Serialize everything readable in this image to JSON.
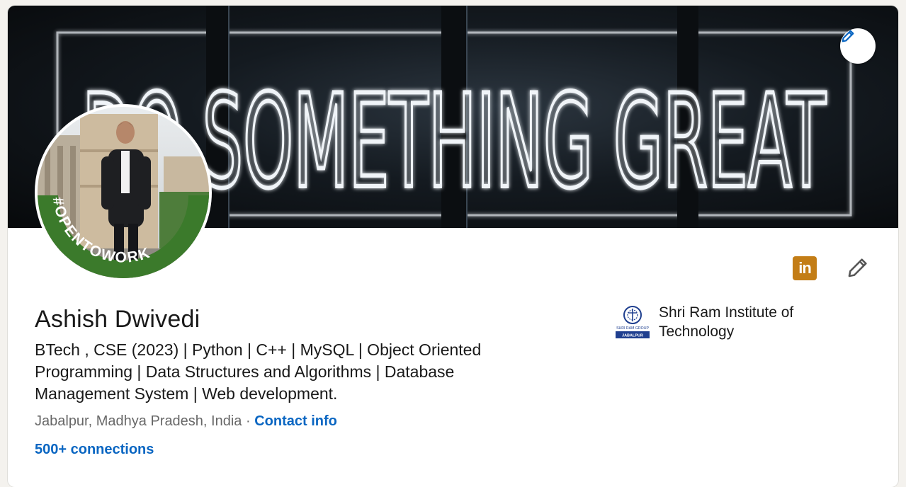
{
  "banner": {
    "neon_text": "DO SOMETHING GREAT",
    "edit_button_label": "Edit background"
  },
  "profile": {
    "open_to_work_badge": "#OPENTOWORK",
    "name": "Ashish Dwivedi",
    "headline": "BTech , CSE (2023) | Python | C++ | MySQL | Object Oriented Programming | Data Structures and Algorithms | Database Management System | Web development.",
    "location": "Jabalpur, Madhya Pradesh, India",
    "separator": " · ",
    "contact_info": "Contact info",
    "connections": "500+ connections"
  },
  "education": {
    "school_name": "Shri Ram Institute of Technology",
    "logo_text_top": "SHRI RAM GROUP",
    "logo_text_bottom": "JABALPUR"
  },
  "icons": {
    "linkedin": "linkedin-icon",
    "banner_edit": "pencil-icon",
    "intro_edit": "pencil-icon"
  },
  "colors": {
    "link_blue": "#0a66c2",
    "open_to_work_green": "#3b7a2b",
    "linkedin_badge": "#c37d16",
    "page_background": "#f4f2ee"
  }
}
